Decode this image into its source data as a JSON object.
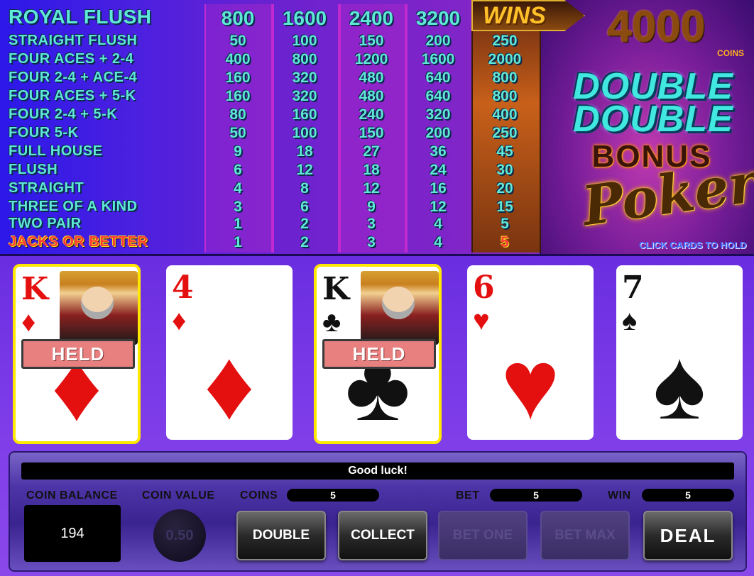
{
  "paytable": {
    "hands": [
      {
        "name": "ROYAL FLUSH",
        "pays": [
          "800",
          "1600",
          "2400",
          "3200",
          "4000"
        ]
      },
      {
        "name": "STRAIGHT FLUSH",
        "pays": [
          "50",
          "100",
          "150",
          "200",
          "250"
        ]
      },
      {
        "name": "FOUR ACES + 2-4",
        "pays": [
          "400",
          "800",
          "1200",
          "1600",
          "2000"
        ]
      },
      {
        "name": "FOUR 2-4 + ACE-4",
        "pays": [
          "160",
          "320",
          "480",
          "640",
          "800"
        ]
      },
      {
        "name": "FOUR ACES + 5-K",
        "pays": [
          "160",
          "320",
          "480",
          "640",
          "800"
        ]
      },
      {
        "name": "FOUR 2-4 + 5-K",
        "pays": [
          "80",
          "160",
          "240",
          "320",
          "400"
        ]
      },
      {
        "name": "FOUR 5-K",
        "pays": [
          "50",
          "100",
          "150",
          "200",
          "250"
        ]
      },
      {
        "name": "FULL HOUSE",
        "pays": [
          "9",
          "18",
          "27",
          "36",
          "45"
        ]
      },
      {
        "name": "FLUSH",
        "pays": [
          "6",
          "12",
          "18",
          "24",
          "30"
        ]
      },
      {
        "name": "STRAIGHT",
        "pays": [
          "4",
          "8",
          "12",
          "16",
          "20"
        ]
      },
      {
        "name": "THREE OF A KIND",
        "pays": [
          "3",
          "6",
          "9",
          "12",
          "15"
        ]
      },
      {
        "name": "TWO PAIR",
        "pays": [
          "1",
          "2",
          "3",
          "4",
          "5"
        ]
      },
      {
        "name": "JACKS OR BETTER",
        "pays": [
          "1",
          "2",
          "3",
          "4",
          "5"
        ]
      }
    ],
    "highlighted_column": 5
  },
  "wins_label": "WINS",
  "win_amount": "4000",
  "coins_label": "COINS",
  "logo": {
    "line1": "DOUBLE",
    "line2": "DOUBLE",
    "line3": "BONUS",
    "line4": "Poker"
  },
  "hold_hint": "CLICK CARDS TO HOLD",
  "cards": [
    {
      "rank": "K",
      "suit": "♦",
      "color": "red",
      "face": true,
      "held": true
    },
    {
      "rank": "4",
      "suit": "♦",
      "color": "red",
      "face": false,
      "held": false
    },
    {
      "rank": "K",
      "suit": "♣",
      "color": "black",
      "face": true,
      "held": true
    },
    {
      "rank": "6",
      "suit": "♥",
      "color": "red",
      "face": false,
      "held": false
    },
    {
      "rank": "7",
      "suit": "♠",
      "color": "black",
      "face": false,
      "held": false
    }
  ],
  "held_label": "HELD",
  "message": "Good luck!",
  "labels": {
    "coin_balance": "COIN BALANCE",
    "coin_value": "COIN VALUE",
    "coins": "COINS",
    "bet": "BET",
    "win": "WIN"
  },
  "values": {
    "coin_balance": "194",
    "coin_value": "0.50",
    "coins": "5",
    "bet": "5",
    "win": "5"
  },
  "buttons": {
    "double": "DOUBLE",
    "collect": "COLLECT",
    "bet_one": "BET ONE",
    "bet_max": "BET MAX",
    "deal": "DEAL"
  }
}
